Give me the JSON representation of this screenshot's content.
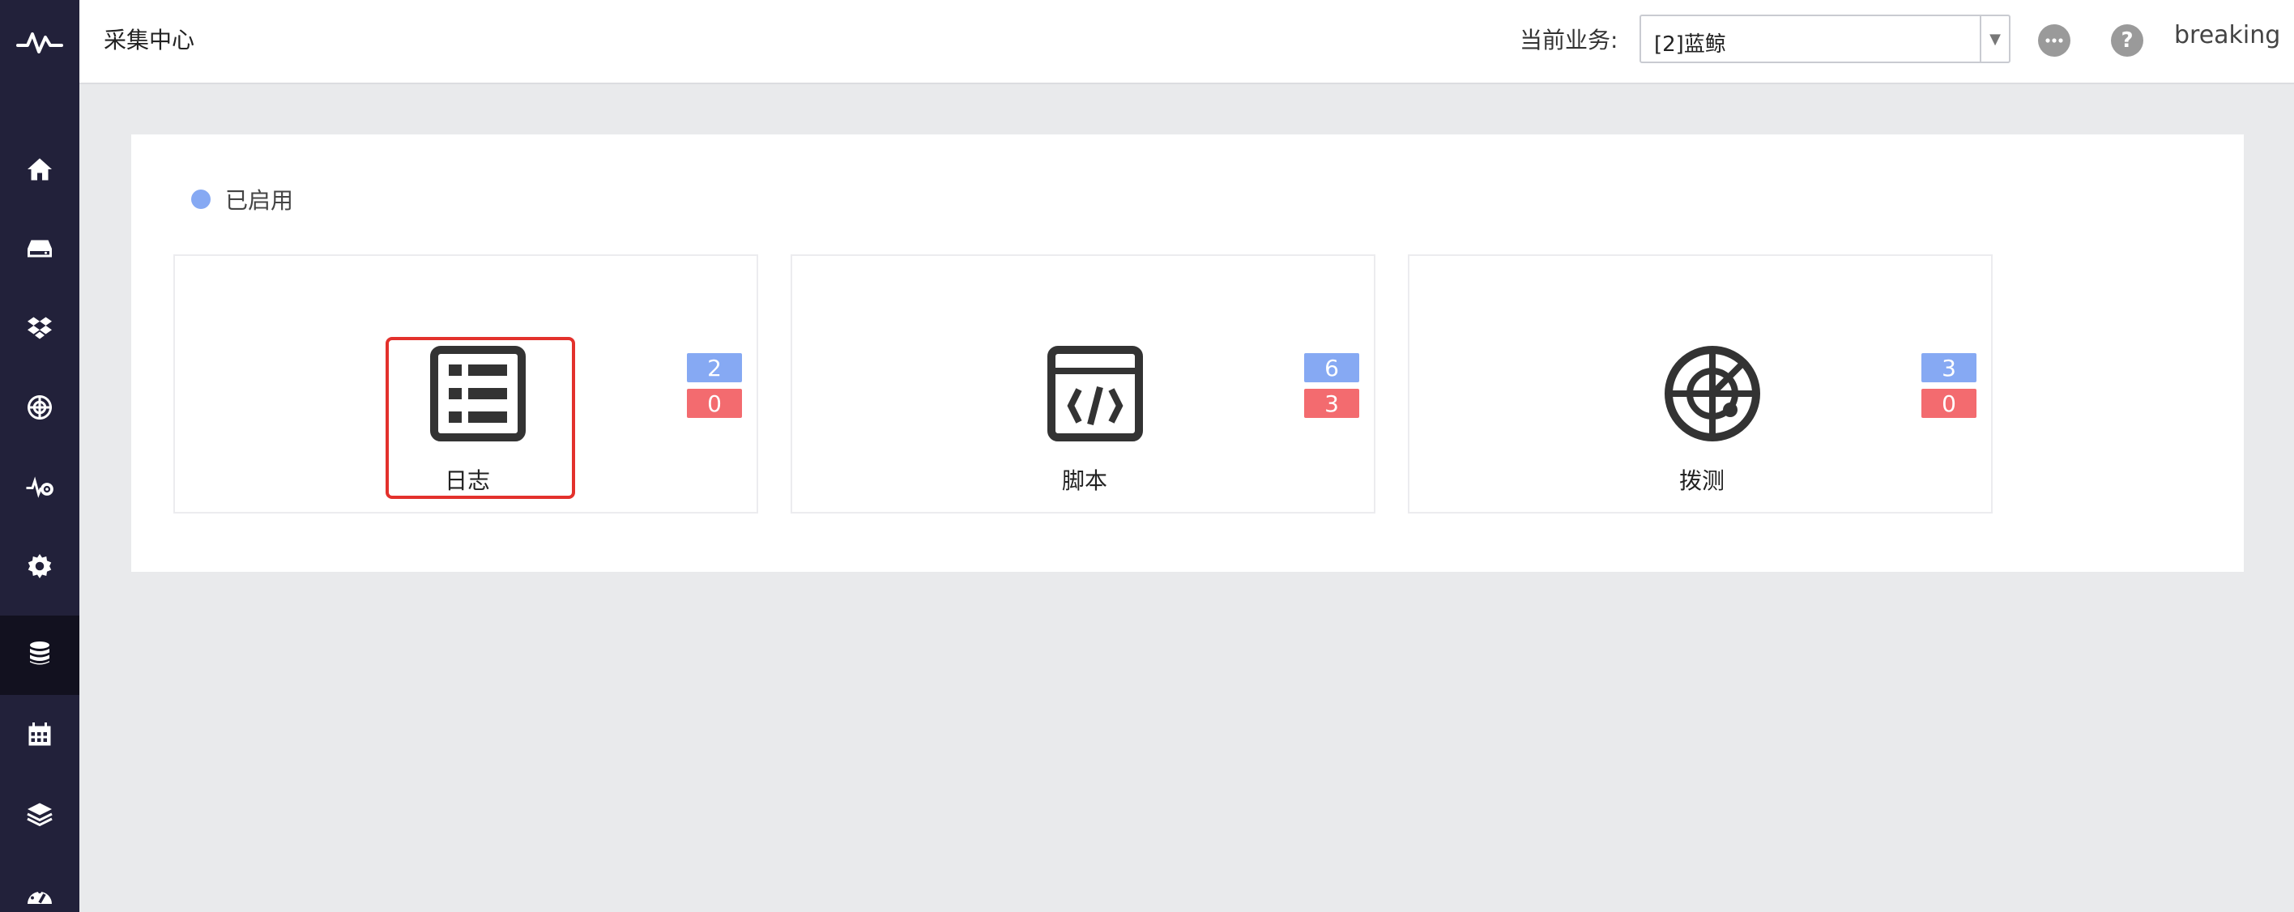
{
  "sidebar": {
    "items": [
      {
        "icon": "home-icon"
      },
      {
        "icon": "storage-icon"
      },
      {
        "icon": "dropbox-icon"
      },
      {
        "icon": "target-icon"
      },
      {
        "icon": "pulse-settings-icon"
      },
      {
        "icon": "gear-icon"
      },
      {
        "icon": "database-icon",
        "active": true
      },
      {
        "icon": "calendar-icon"
      },
      {
        "icon": "layers-icon"
      },
      {
        "icon": "dashboard-icon"
      }
    ]
  },
  "header": {
    "title": "采集中心",
    "business_label": "当前业务:",
    "business_value": "[2]蓝鲸",
    "username": "breaking",
    "help_symbol": "?"
  },
  "main": {
    "legend_label": "已启用",
    "legend_color": "#86a9f3",
    "cards": [
      {
        "label": "日志",
        "icon": "log-list-icon",
        "enabled_count": "2",
        "disabled_count": "0",
        "highlighted": true
      },
      {
        "label": "脚本",
        "icon": "script-code-icon",
        "enabled_count": "6",
        "disabled_count": "3"
      },
      {
        "label": "拨测",
        "icon": "radar-icon",
        "enabled_count": "3",
        "disabled_count": "0"
      }
    ]
  },
  "colors": {
    "sidebar_bg": "#22213a",
    "badge_blue": "#86a9f3",
    "badge_red": "#f36b6f",
    "highlight": "#e3312c"
  }
}
